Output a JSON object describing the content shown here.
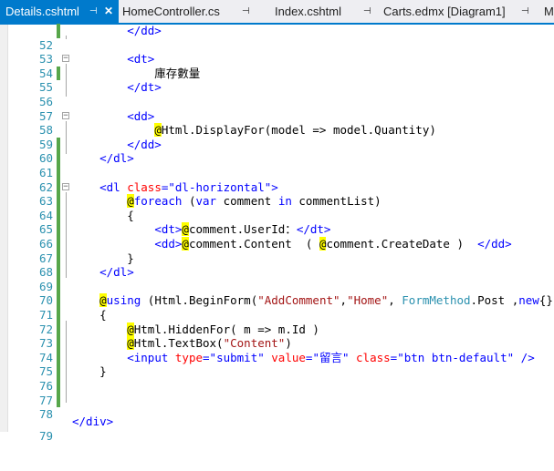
{
  "tabs": [
    {
      "label": "Details.cshtml",
      "pin": "⊣",
      "close": "✕",
      "active": true
    },
    {
      "label": "HomeController.cs",
      "pin": "⊣",
      "active": false
    },
    {
      "label": "Index.cshtml",
      "pin": "⊣",
      "active": false
    },
    {
      "label": "Carts.edmx [Diagram1]",
      "pin": "⊣",
      "active": false
    },
    {
      "label": "M",
      "active": false
    }
  ],
  "editor": {
    "lines": [
      {
        "num": "52",
        "code": "        </dd>"
      },
      {
        "num": "53",
        "code": ""
      },
      {
        "num": "54",
        "code": "        <dt>"
      },
      {
        "num": "55",
        "code": "            庫存數量"
      },
      {
        "num": "56",
        "code": "        </dt>"
      },
      {
        "num": "57",
        "code": ""
      },
      {
        "num": "58",
        "code": "        <dd>"
      },
      {
        "num": "59",
        "code": "            @Html.DisplayFor(model => model.Quantity)"
      },
      {
        "num": "60",
        "code": "        </dd>"
      },
      {
        "num": "61",
        "code": "    </dl>"
      },
      {
        "num": "62",
        "code": ""
      },
      {
        "num": "63",
        "code": "    <dl class=\"dl-horizontal\">"
      },
      {
        "num": "64",
        "code": "        @foreach (var comment in commentList)"
      },
      {
        "num": "65",
        "code": "        {"
      },
      {
        "num": "66",
        "code": "            <dt>@comment.UserId：</dt>"
      },
      {
        "num": "67",
        "code": "            <dd>@comment.Content  ( @comment.CreateDate )  </dd>"
      },
      {
        "num": "68",
        "code": "        }"
      },
      {
        "num": "69",
        "code": "    </dl>"
      },
      {
        "num": "70",
        "code": ""
      },
      {
        "num": "71",
        "code": "    @using (Html.BeginForm(\"AddComment\",\"Home\", FormMethod.Post ,new{}))"
      },
      {
        "num": "72",
        "code": "    {"
      },
      {
        "num": "73",
        "code": "        @Html.HiddenFor( m => m.Id )"
      },
      {
        "num": "74",
        "code": "        @Html.TextBox(\"Content\")"
      },
      {
        "num": "75",
        "code": "        <input type=\"submit\" value=\"留言\" class=\"btn btn-default\" />"
      },
      {
        "num": "76",
        "code": "    }"
      },
      {
        "num": "77",
        "code": ""
      },
      {
        "num": "78",
        "code": ""
      },
      {
        "num": "79",
        "code": "</div>"
      }
    ]
  },
  "colors": {
    "accent": "#007acc",
    "line_number": "#2b91af",
    "tag": "#0000ff",
    "attribute": "#ff0000",
    "razor_highlight": "#ffff00",
    "csharp_string": "#a31515",
    "change_saved": "#57a64a"
  }
}
